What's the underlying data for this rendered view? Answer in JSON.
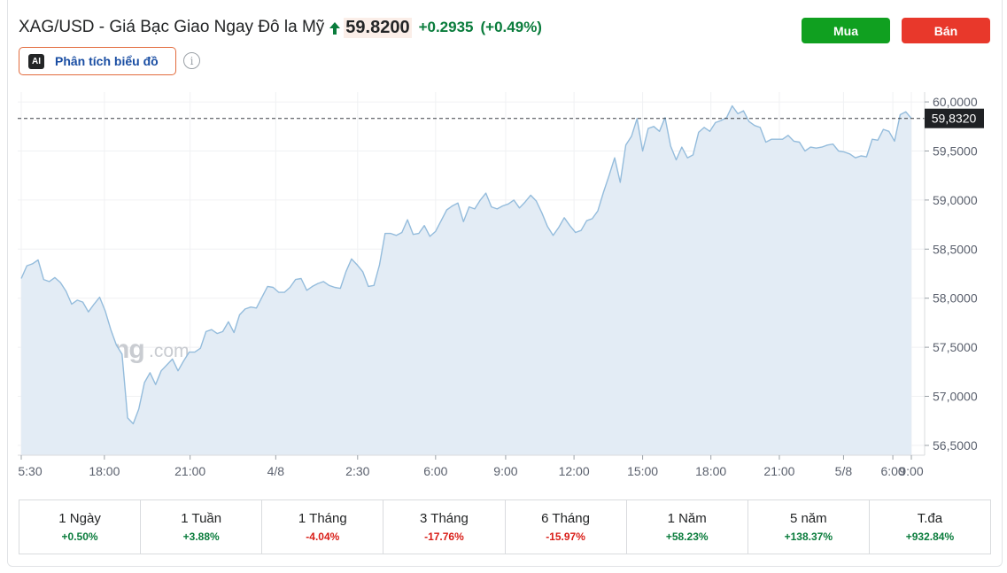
{
  "header": {
    "title": "XAG/USD - Giá Bạc Giao Ngay Đô la Mỹ",
    "price": "59.8200",
    "change": "+0.2935",
    "change_pct": "(+0.49%)",
    "direction_icon": "arrow-up-icon",
    "up_color": "#0a7c3c"
  },
  "ai_button": {
    "badge": "AI",
    "label": "Phân tích biểu đồ"
  },
  "info_icon": "info-icon",
  "buttons": {
    "buy": "Mua",
    "sell": "Bán",
    "buy_color": "#10a020",
    "sell_color": "#e8382b"
  },
  "watermark": {
    "brand": "Investing",
    "suffix": ".com"
  },
  "chart_data": {
    "type": "area",
    "series": [
      {
        "values": [
          58.2,
          58.33,
          58.35,
          58.39,
          58.19,
          58.17,
          58.21,
          58.16,
          58.07,
          57.94,
          57.98,
          57.96,
          57.86,
          57.94,
          58.01,
          57.87,
          57.68,
          57.52,
          57.43,
          56.78,
          56.72,
          56.87,
          57.14,
          57.24,
          57.12,
          57.26,
          57.32,
          57.38,
          57.26,
          57.36,
          57.45,
          57.45,
          57.49,
          57.66,
          57.68,
          57.64,
          57.66,
          57.76,
          57.65,
          57.83,
          57.89,
          57.91,
          57.9,
          58.01,
          58.12,
          58.11,
          58.06,
          58.06,
          58.11,
          58.19,
          58.2,
          58.08,
          58.12,
          58.15,
          58.17,
          58.13,
          58.11,
          58.1,
          58.27,
          58.4,
          58.34,
          58.27,
          58.12,
          58.13,
          58.34,
          58.66,
          58.66,
          58.64,
          58.67,
          58.8,
          58.65,
          58.66,
          58.74,
          58.63,
          58.68,
          58.79,
          58.9,
          58.94,
          58.97,
          58.78,
          58.93,
          58.91,
          59.0,
          59.07,
          58.93,
          58.91,
          58.94,
          58.96,
          59.0,
          58.92,
          58.98,
          59.05,
          58.99,
          58.87,
          58.73,
          58.64,
          58.72,
          58.82,
          58.74,
          58.67,
          58.69,
          58.79,
          58.81,
          58.89,
          59.08,
          59.25,
          59.43,
          59.18,
          59.56,
          59.65,
          59.83,
          59.5,
          59.73,
          59.75,
          59.7,
          59.84,
          59.55,
          59.41,
          59.54,
          59.43,
          59.46,
          59.69,
          59.74,
          59.7,
          59.79,
          59.81,
          59.84,
          59.96,
          59.88,
          59.91,
          59.8,
          59.76,
          59.74,
          59.59,
          59.62,
          59.62,
          59.62,
          59.66,
          59.6,
          59.59,
          59.5,
          59.54,
          59.53,
          59.54,
          59.56,
          59.57,
          59.5,
          59.49,
          59.47,
          59.43,
          59.45,
          59.44,
          59.62,
          59.61,
          59.72,
          59.7,
          59.6,
          59.87,
          59.9,
          59.832
        ]
      }
    ],
    "current_value_label": "59,8320",
    "current_value": 59.832,
    "y_ticks": [
      "60,0000",
      "59,5000",
      "59,0000",
      "58,5000",
      "58,0000",
      "57,5000",
      "57,0000",
      "56,5000"
    ],
    "y_tick_values": [
      60.0,
      59.5,
      59.0,
      58.5,
      58.0,
      57.5,
      57.0,
      56.5
    ],
    "ylim": [
      56.4,
      60.1
    ],
    "x_ticks": [
      "5:30",
      "18:00",
      "21:00",
      "4/8",
      "2:30",
      "6:00",
      "9:00",
      "12:00",
      "15:00",
      "18:00",
      "21:00",
      "5/8",
      "6:00",
      "9:00"
    ],
    "x_tick_fracs": [
      0.0,
      0.0934,
      0.1897,
      0.2859,
      0.3779,
      0.4655,
      0.5442,
      0.621,
      0.6981,
      0.7748,
      0.8517,
      0.9238,
      0.9792,
      1.0
    ],
    "grid": true,
    "line_color": "#94bcdc",
    "fill_color": "#e3ecf5"
  },
  "performance": [
    {
      "label": "1 Ngày",
      "value": "+0.50%",
      "dir": "pos"
    },
    {
      "label": "1 Tuần",
      "value": "+3.88%",
      "dir": "pos"
    },
    {
      "label": "1 Tháng",
      "value": "-4.04%",
      "dir": "neg"
    },
    {
      "label": "3 Tháng",
      "value": "-17.76%",
      "dir": "neg"
    },
    {
      "label": "6 Tháng",
      "value": "-15.97%",
      "dir": "neg"
    },
    {
      "label": "1 Năm",
      "value": "+58.23%",
      "dir": "pos"
    },
    {
      "label": "5 năm",
      "value": "+138.37%",
      "dir": "pos"
    },
    {
      "label": "T.đa",
      "value": "+932.84%",
      "dir": "pos"
    }
  ]
}
